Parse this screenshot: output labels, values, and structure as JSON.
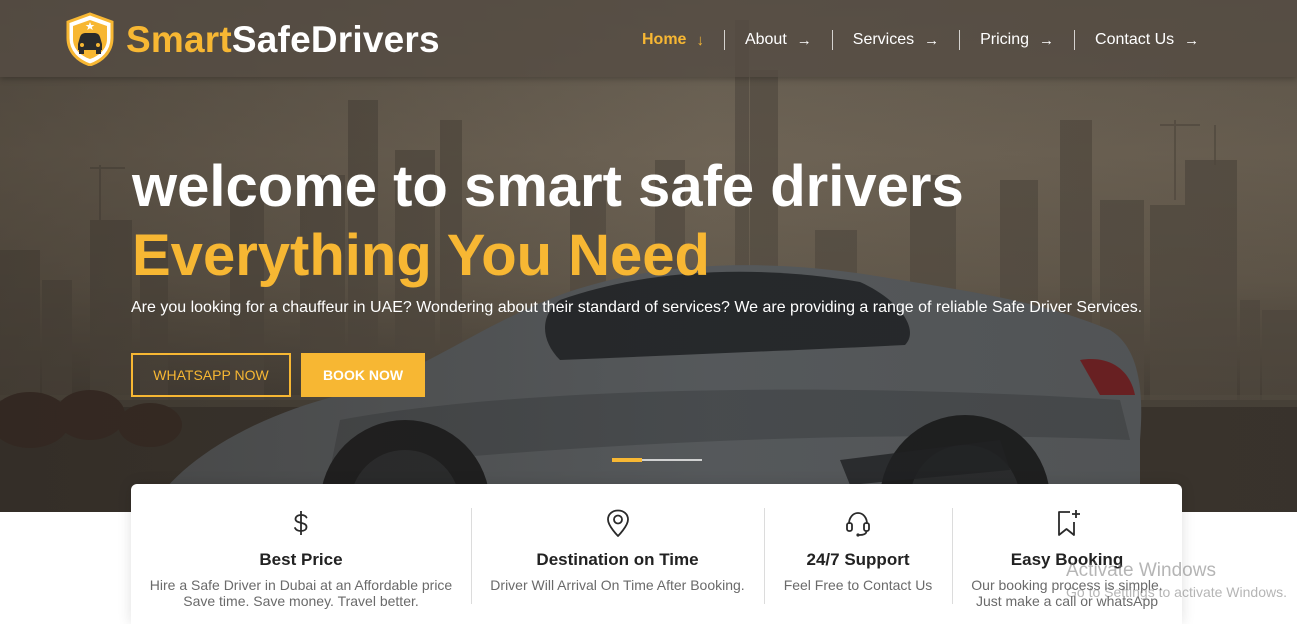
{
  "brand": {
    "name_part1": "Smart",
    "name_part2": "SafeDrivers",
    "logo_icon": "shield-car-icon",
    "accent_color": "#f7b733"
  },
  "nav": {
    "items": [
      {
        "label": "Home",
        "arrow": "↓",
        "active": true
      },
      {
        "label": "About",
        "arrow": "→",
        "active": false
      },
      {
        "label": "Services",
        "arrow": "→",
        "active": false
      },
      {
        "label": "Pricing",
        "arrow": "→",
        "active": false
      },
      {
        "label": "Contact Us",
        "arrow": "→",
        "active": false
      }
    ]
  },
  "hero": {
    "headline": "welcome to smart safe drivers",
    "subheadline": "Everything You Need",
    "lead": "Are you looking for a chauffeur in UAE? Wondering about their standard of services? We are providing a range of reliable Safe Driver Services.",
    "primary_button": "WHATSAPP NOW",
    "secondary_button": "BOOK NOW",
    "slides_total": 2,
    "active_slide": 1
  },
  "features": [
    {
      "icon": "dollar-icon",
      "title": "Best Price",
      "desc_line1": "Hire a Safe Driver in Dubai at an Affordable price",
      "desc_line2": "Save time. Save money. Travel better."
    },
    {
      "icon": "map-pin-icon",
      "title": "Destination on Time",
      "desc_line1": "Driver Will Arrival On Time After Booking.",
      "desc_line2": ""
    },
    {
      "icon": "headset-icon",
      "title": "24/7 Support",
      "desc_line1": "Feel Free to Contact Us",
      "desc_line2": ""
    },
    {
      "icon": "bookmark-plus-icon",
      "title": "Easy Booking",
      "desc_line1": "Our booking process is simple.",
      "desc_line2": "Just make a call or whatsApp"
    }
  ],
  "watermark": {
    "line1": "Activate Windows",
    "line2": "Go to Settings to activate Windows."
  }
}
